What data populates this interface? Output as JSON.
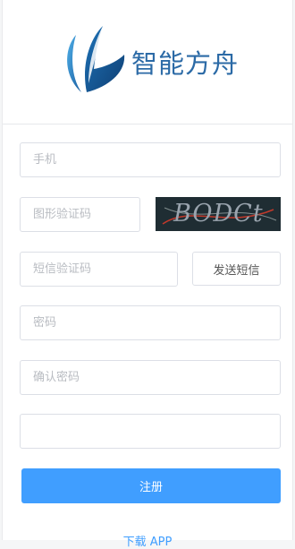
{
  "brand": {
    "name": "智能方舟",
    "logo_icon": "sail-logo-icon",
    "color": "#2b6aa6"
  },
  "form": {
    "phone": {
      "placeholder": "手机",
      "value": ""
    },
    "captcha": {
      "placeholder": "图形验证码",
      "value": "",
      "image_text": "BODCt"
    },
    "sms_code": {
      "placeholder": "短信验证码",
      "value": ""
    },
    "send_sms_label": "发送短信",
    "password": {
      "placeholder": "密码",
      "value": ""
    },
    "confirm_password": {
      "placeholder": "确认密码",
      "value": ""
    },
    "extra": {
      "placeholder": "",
      "value": ""
    },
    "register_label": "注册"
  },
  "footer": {
    "download_label": "下载 APP"
  },
  "colors": {
    "primary": "#409eff",
    "border": "#dcdfe6",
    "placeholder": "#b9bcc2"
  }
}
